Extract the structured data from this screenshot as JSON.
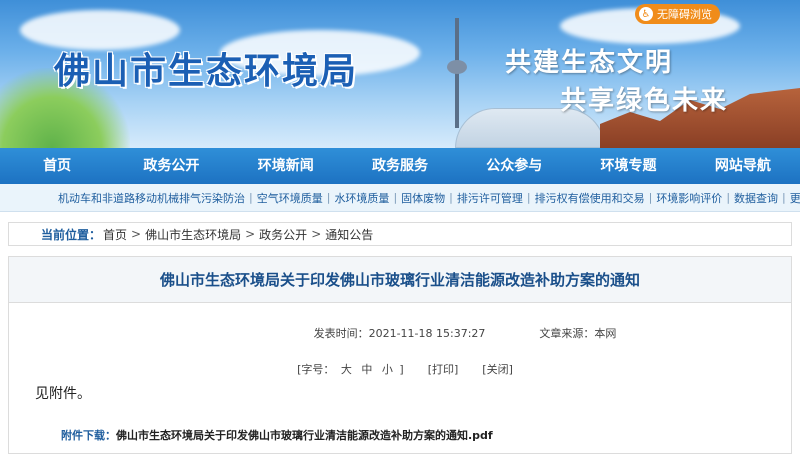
{
  "banner": {
    "site_title": "佛山市生态环境局",
    "slogan_line1": "共建生态文明",
    "slogan_line2": "共享绿色未来",
    "accessibility_label": "无障碍浏览",
    "accessibility_icon": "wheelchair-icon"
  },
  "main_nav": [
    {
      "label": "首页"
    },
    {
      "label": "政务公开"
    },
    {
      "label": "环境新闻"
    },
    {
      "label": "政务服务"
    },
    {
      "label": "公众参与"
    },
    {
      "label": "环境专题"
    },
    {
      "label": "网站导航"
    }
  ],
  "sub_nav": [
    {
      "label": "机动车和非道路移动机械排气污染防治"
    },
    {
      "label": "空气环境质量"
    },
    {
      "label": "水环境质量"
    },
    {
      "label": "固体废物"
    },
    {
      "label": "排污许可管理"
    },
    {
      "label": "排污权有偿使用和交易"
    },
    {
      "label": "环境影响评价"
    },
    {
      "label": "数据查询"
    },
    {
      "label": "更多"
    }
  ],
  "breadcrumb": {
    "label": "当前位置：",
    "items": [
      "首页",
      "佛山市生态环境局",
      "政务公开",
      "通知公告"
    ],
    "separator": ">"
  },
  "article": {
    "title": "佛山市生态环境局关于印发佛山市玻璃行业清洁能源改造补助方案的通知",
    "publish_time": "发表时间：2021-11-18 15:37:27",
    "source": "文章来源：本网",
    "font_size_prefix": "[字号：",
    "font_sizes": [
      "大",
      "中",
      "小"
    ],
    "font_size_suffix": "]",
    "print_label": "[打印]",
    "close_label": "[关闭]",
    "body": "见附件。",
    "attachment_label": "附件下载：",
    "attachment_file": "佛山市生态环境局关于印发佛山市玻璃行业清洁能源改造补助方案的通知.pdf"
  },
  "colors": {
    "nav_blue": "#1d72c2",
    "title_blue": "#1a4f8a",
    "link_blue": "#1f5e9e",
    "accent_orange": "#f08c1a"
  }
}
